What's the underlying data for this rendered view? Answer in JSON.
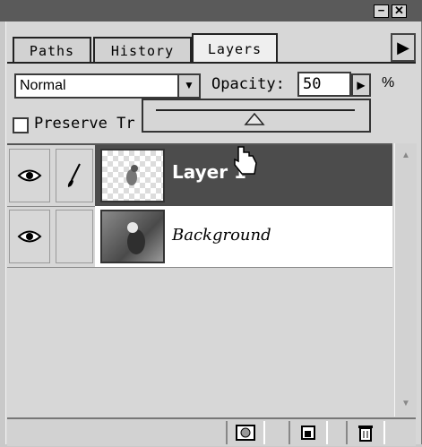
{
  "tabs": [
    "Paths",
    "History",
    "Layers"
  ],
  "active_tab": "Layers",
  "blend_mode": "Normal",
  "opacity": {
    "label": "Opacity:",
    "value": "50",
    "unit": "%"
  },
  "preserve_transparency": {
    "label": "Preserve Tr",
    "checked": false
  },
  "layers": [
    {
      "name": "Layer 1",
      "visible": true,
      "brush": true,
      "selected": true
    },
    {
      "name": "Background",
      "visible": true,
      "brush": false,
      "selected": false
    }
  ],
  "icons": {
    "minimize": "minimize-icon",
    "close": "close-icon",
    "panel_menu": "triangle-right-icon",
    "eye": "eye-icon",
    "brush": "paintbrush-icon",
    "add_mask": "add-layer-mask-icon",
    "new_layer": "new-layer-icon",
    "delete": "trash-icon"
  }
}
